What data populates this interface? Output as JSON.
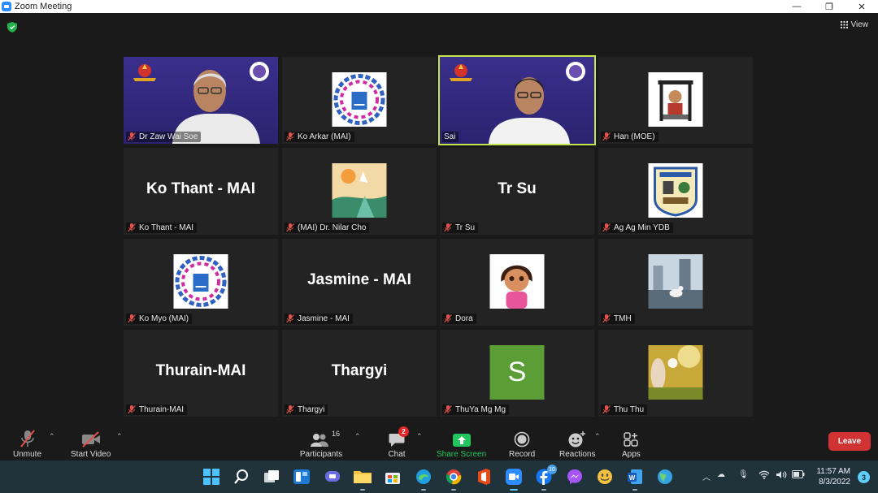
{
  "window": {
    "title": "Zoom Meeting",
    "minimize": "—",
    "restore": "❐",
    "close": "✕"
  },
  "header": {
    "view_label": "View"
  },
  "participants": [
    {
      "name": "Dr Zaw Wai Soe",
      "kind": "video"
    },
    {
      "name": "Ko Arkar (MAI)",
      "kind": "logo-mai"
    },
    {
      "name": "Sai",
      "kind": "video",
      "active_speaker": true
    },
    {
      "name": "Han (MOE)",
      "kind": "logo-loom"
    },
    {
      "name": "Ko Thant - MAI",
      "display": "Ko Thant - MAI",
      "kind": "text"
    },
    {
      "name": "(MAI) Dr. Nilar Cho",
      "kind": "art"
    },
    {
      "name": "Tr Su",
      "display": "Tr Su",
      "kind": "text"
    },
    {
      "name": "Ag Ag Min YDB",
      "kind": "logo-ydb"
    },
    {
      "name": "Ko Myo (MAI)",
      "kind": "logo-mai"
    },
    {
      "name": "Jasmine - MAI",
      "display": "Jasmine - MAI",
      "kind": "text"
    },
    {
      "name": "Dora",
      "kind": "cartoon"
    },
    {
      "name": "TMH",
      "kind": "photo-city"
    },
    {
      "name": "Thurain-MAI",
      "display": "Thurain-MAI",
      "kind": "text"
    },
    {
      "name": "Thargyi",
      "display": "Thargyi",
      "kind": "text"
    },
    {
      "name": "ThuYa Mg Mg",
      "kind": "initial",
      "initial": "S",
      "color": "#5a9e35"
    },
    {
      "name": "Thu Thu",
      "kind": "photo-flower"
    }
  ],
  "toolbar": {
    "unmute": "Unmute",
    "start_video": "Start Video",
    "participants": "Participants",
    "participant_count": "16",
    "chat": "Chat",
    "chat_badge": "2",
    "share_screen": "Share Screen",
    "record": "Record",
    "reactions": "Reactions",
    "apps": "Apps",
    "leave": "Leave"
  },
  "colors": {
    "active_border": "#c5e34c",
    "share_green": "#22c55e",
    "leave_red": "#d13232",
    "muted_red": "#e0524b"
  },
  "taskbar": {
    "facebook_badge": "10",
    "time": "11:57 AM",
    "date": "8/3/2022",
    "notifications": "3"
  }
}
